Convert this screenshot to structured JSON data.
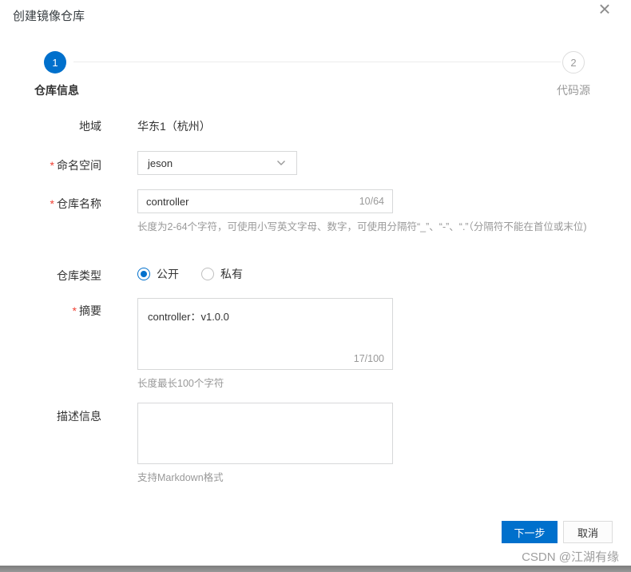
{
  "colors": {
    "accent": "#0070cc",
    "required_mark": "#f04134"
  },
  "icons": {
    "close": "×",
    "chevron_down": "chevron-down"
  },
  "dialog": {
    "title": "创建镜像仓库"
  },
  "steps": [
    {
      "number": "1",
      "label": "仓库信息",
      "active": true
    },
    {
      "number": "2",
      "label": "代码源",
      "active": false
    }
  ],
  "form": {
    "region": {
      "label": "地域",
      "value": "华东1（杭州）"
    },
    "namespace": {
      "required_mark": "*",
      "label": "命名空间",
      "value": "jeson"
    },
    "repo_name": {
      "required_mark": "*",
      "label": "仓库名称",
      "value": "controller",
      "counter": "10/64",
      "hint": "长度为2-64个字符，可使用小写英文字母、数字，可使用分隔符“_”、“-”、“.”（分隔符不能在首位或末位)"
    },
    "repo_type": {
      "label": "仓库类型",
      "options": [
        {
          "label": "公开",
          "selected": true
        },
        {
          "label": "私有",
          "selected": false
        }
      ]
    },
    "summary": {
      "required_mark": "*",
      "label": "摘要",
      "value": "controller：v1.0.0",
      "counter": "17/100",
      "hint": "长度最长100个字符"
    },
    "description": {
      "label": "描述信息",
      "value": "",
      "hint": "支持Markdown格式"
    }
  },
  "footer": {
    "next_label": "下一步",
    "cancel_label": "取消"
  },
  "watermark": "CSDN @江湖有缘"
}
